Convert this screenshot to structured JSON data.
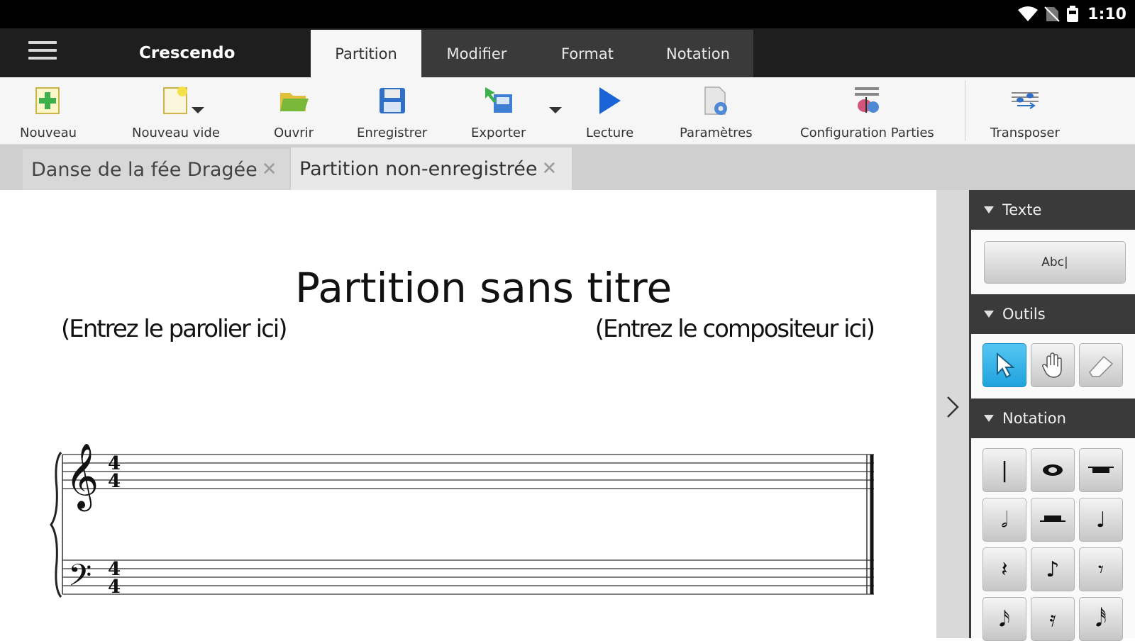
{
  "status_bar": {
    "time": "1:10",
    "icons": [
      "wifi-icon",
      "no-sim-icon",
      "battery-icon"
    ]
  },
  "app": {
    "title": "Crescendo"
  },
  "ribbon_tabs": [
    {
      "label": "Partition",
      "active": true
    },
    {
      "label": "Modifier",
      "active": false
    },
    {
      "label": "Format",
      "active": false
    },
    {
      "label": "Notation",
      "active": false
    }
  ],
  "toolbar": {
    "new": "Nouveau",
    "new_blank": "Nouveau vide",
    "open": "Ouvrir",
    "save": "Enregistrer",
    "export": "Exporter",
    "play": "Lecture",
    "settings": "Paramètres",
    "parts_config": "Configuration Parties",
    "transpose": "Transposer"
  },
  "doc_tabs": [
    {
      "label": "Danse de la fée Dragée",
      "active": false
    },
    {
      "label": "Partition non-enregistrée",
      "active": true
    }
  ],
  "score": {
    "title": "Partition sans titre",
    "lyricist": "(Entrez le parolier ici)",
    "composer": "(Entrez le compositeur ici)",
    "time_signature": {
      "top": "4",
      "bottom": "4"
    }
  },
  "panel": {
    "text_section": "Texte",
    "text_button": "Abc|",
    "tools_section": "Outils",
    "tools": [
      "select-arrow-icon",
      "hand-icon",
      "eraser-icon"
    ],
    "notation_section": "Notation"
  },
  "colors": {
    "accent": "#2aa8e0",
    "dark_bar": "#1e1e1e",
    "ribbon_tab_bg": "#3a3a3a",
    "toolbar_bg": "#f6f6f6",
    "play_blue": "#1b64d8"
  }
}
